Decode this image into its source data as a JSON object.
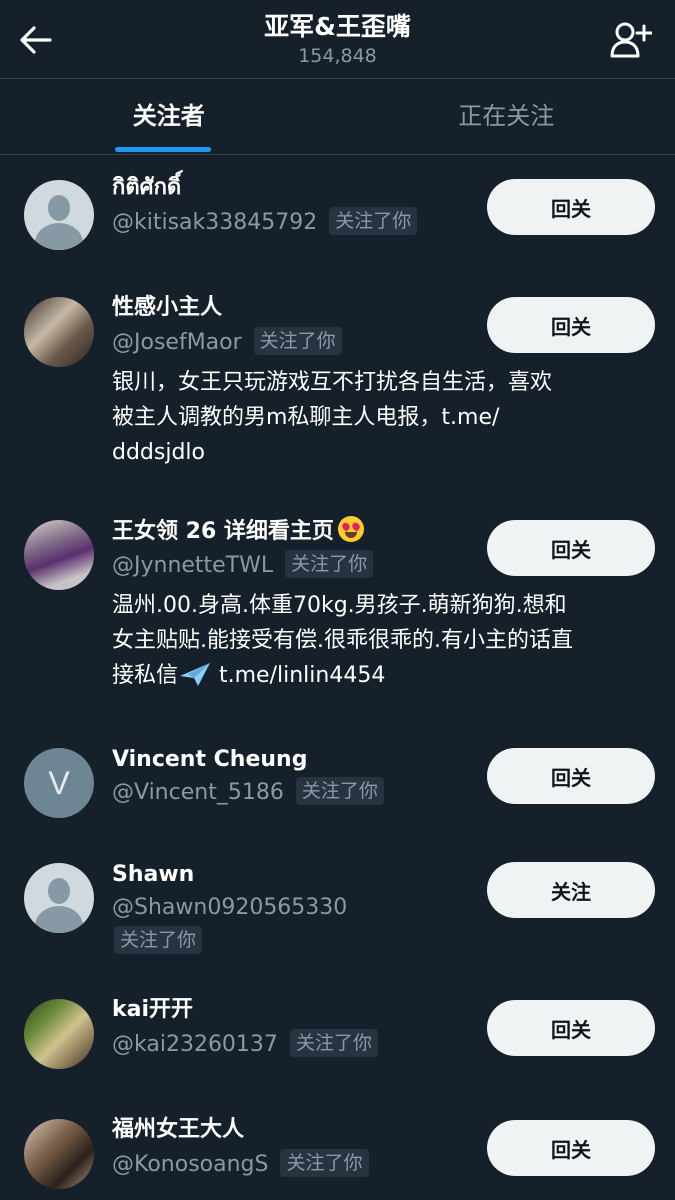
{
  "header": {
    "title": "亚军&王歪嘴",
    "count": "154,848",
    "back_icon": "arrow-left-icon",
    "add_icon": "add-user-icon"
  },
  "tabs": [
    {
      "label": "关注者",
      "active": true
    },
    {
      "label": "正在关注",
      "active": false
    }
  ],
  "follows_you_label": "关注了你",
  "users": [
    {
      "name": "กิติศักดิ์",
      "handle": "@kitisak33845792",
      "button": "回关",
      "avatar": "default-avatar"
    },
    {
      "name": "性感小主人",
      "handle": "@JosefMaor",
      "button": "回关",
      "avatar": "photo-avatar",
      "bio": [
        "银川，女王只玩游戏互不打扰各自生活，喜欢",
        "被主人调教的男m私聊主人电报，t.me/",
        "dddsjdlo"
      ]
    },
    {
      "name": "王女领 26 详细看主页",
      "handle": "@JynnetteTWL",
      "button": "回关",
      "avatar": "photo-avatar",
      "emoji": "heart-eyes-emoji",
      "bio": [
        "温州.00.身高.体重70kg.男孩子.萌新狗狗.想和",
        "女主贴贴.能接受有偿.很乖很乖的.有小主的话直",
        "接私信",
        " t.me/linlin4454"
      ]
    },
    {
      "name": "Vincent Cheung",
      "handle": "@Vincent_5186",
      "button": "回关",
      "avatar": "letter-avatar",
      "avatar_letter": "V"
    },
    {
      "name": "Shawn",
      "handle": "@Shawn0920565330",
      "button": "关注",
      "avatar": "default-avatar"
    },
    {
      "name": "kai开开",
      "handle": "@kai23260137",
      "button": "回关",
      "avatar": "photo-avatar"
    },
    {
      "name": "福州女王大人",
      "handle": "@KonosoangS",
      "button": "回关",
      "avatar": "photo-avatar"
    }
  ],
  "colors": {
    "background": "#15202b",
    "accent": "#1d9bf0",
    "muted": "#8b98a5",
    "button_bg": "#eff3f4"
  }
}
